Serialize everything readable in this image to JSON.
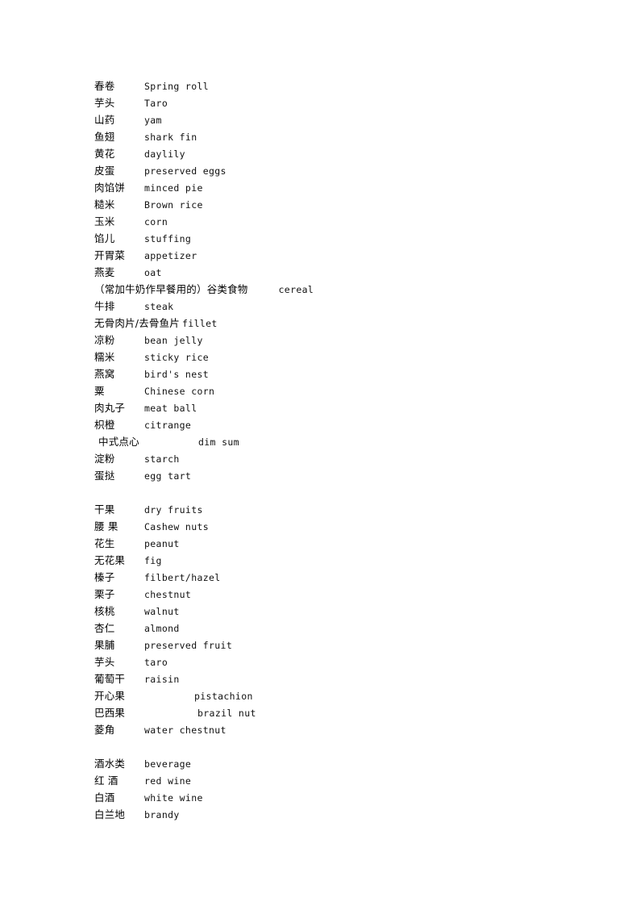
{
  "document": {
    "title": "Chinese-English Food Glossary",
    "language": "zh-CN / en",
    "background_color": "#ffffff",
    "text_color": "#000000"
  },
  "sections": [
    {
      "name": "staples-and-dishes",
      "entries": [
        {
          "term": "春卷",
          "gloss": "Spring roll"
        },
        {
          "term": "芋头",
          "gloss": "Taro"
        },
        {
          "term": "山药",
          "gloss": "yam"
        },
        {
          "term": "鱼翅",
          "gloss": "shark fin"
        },
        {
          "term": "黄花",
          "gloss": "daylily"
        },
        {
          "term": "皮蛋",
          "gloss": "preserved eggs"
        },
        {
          "term": "肉馅饼",
          "gloss": "minced pie"
        },
        {
          "term": "糙米",
          "gloss": "Brown rice"
        },
        {
          "term": "玉米",
          "gloss": "corn"
        },
        {
          "term": "馅儿",
          "gloss": "stuffing"
        },
        {
          "term": "开胃菜",
          "gloss": "appetizer"
        },
        {
          "term": "燕麦",
          "gloss": "oat"
        },
        {
          "term": "（常加牛奶作早餐用的）谷类食物",
          "gloss": "cereal",
          "style": "long"
        },
        {
          "term": "牛排",
          "gloss": "steak"
        },
        {
          "term": "无骨肉片/去骨鱼片",
          "gloss": "fillet",
          "style": "flow"
        },
        {
          "term": "凉粉",
          "gloss": "bean jelly"
        },
        {
          "term": "糯米",
          "gloss": "sticky rice"
        },
        {
          "term": "燕窝",
          "gloss": "bird's nest"
        },
        {
          "term": "粟",
          "gloss": "Chinese corn"
        },
        {
          "term": "肉丸子",
          "gloss": "meat ball"
        },
        {
          "term": "枳橙",
          "gloss": "citrange"
        },
        {
          "term": "中式点心",
          "gloss": "dim sum",
          "style": "indent wide"
        },
        {
          "term": "淀粉",
          "gloss": "starch"
        },
        {
          "term": "蛋挞",
          "gloss": "egg tart"
        }
      ]
    },
    {
      "name": "dried-fruits-and-nuts",
      "entries": [
        {
          "term": "干果",
          "gloss": "dry fruits"
        },
        {
          "term": "腰 果",
          "gloss": "Cashew nuts"
        },
        {
          "term": "花生",
          "gloss": "peanut"
        },
        {
          "term": "无花果",
          "gloss": "fig"
        },
        {
          "term": "榛子",
          "gloss": "filbert/hazel"
        },
        {
          "term": "栗子",
          "gloss": "chestnut"
        },
        {
          "term": "核桃",
          "gloss": "walnut"
        },
        {
          "term": "杏仁",
          "gloss": "almond"
        },
        {
          "term": "果脯",
          "gloss": "preserved fruit"
        },
        {
          "term": "芋头",
          "gloss": "taro"
        },
        {
          "term": "葡萄干",
          "gloss": "raisin"
        },
        {
          "term": "开心果",
          "gloss": "pistachion",
          "style": "wide"
        },
        {
          "term": "巴西果",
          "gloss": "brazil nut",
          "style": "wide2"
        },
        {
          "term": "菱角",
          "gloss": "water chestnut"
        }
      ]
    },
    {
      "name": "beverages",
      "entries": [
        {
          "term": "酒水类",
          "gloss": "beverage"
        },
        {
          "term": "红 酒",
          "gloss": "red wine"
        },
        {
          "term": "白酒",
          "gloss": "white wine"
        },
        {
          "term": "白兰地",
          "gloss": "brandy"
        }
      ]
    }
  ]
}
